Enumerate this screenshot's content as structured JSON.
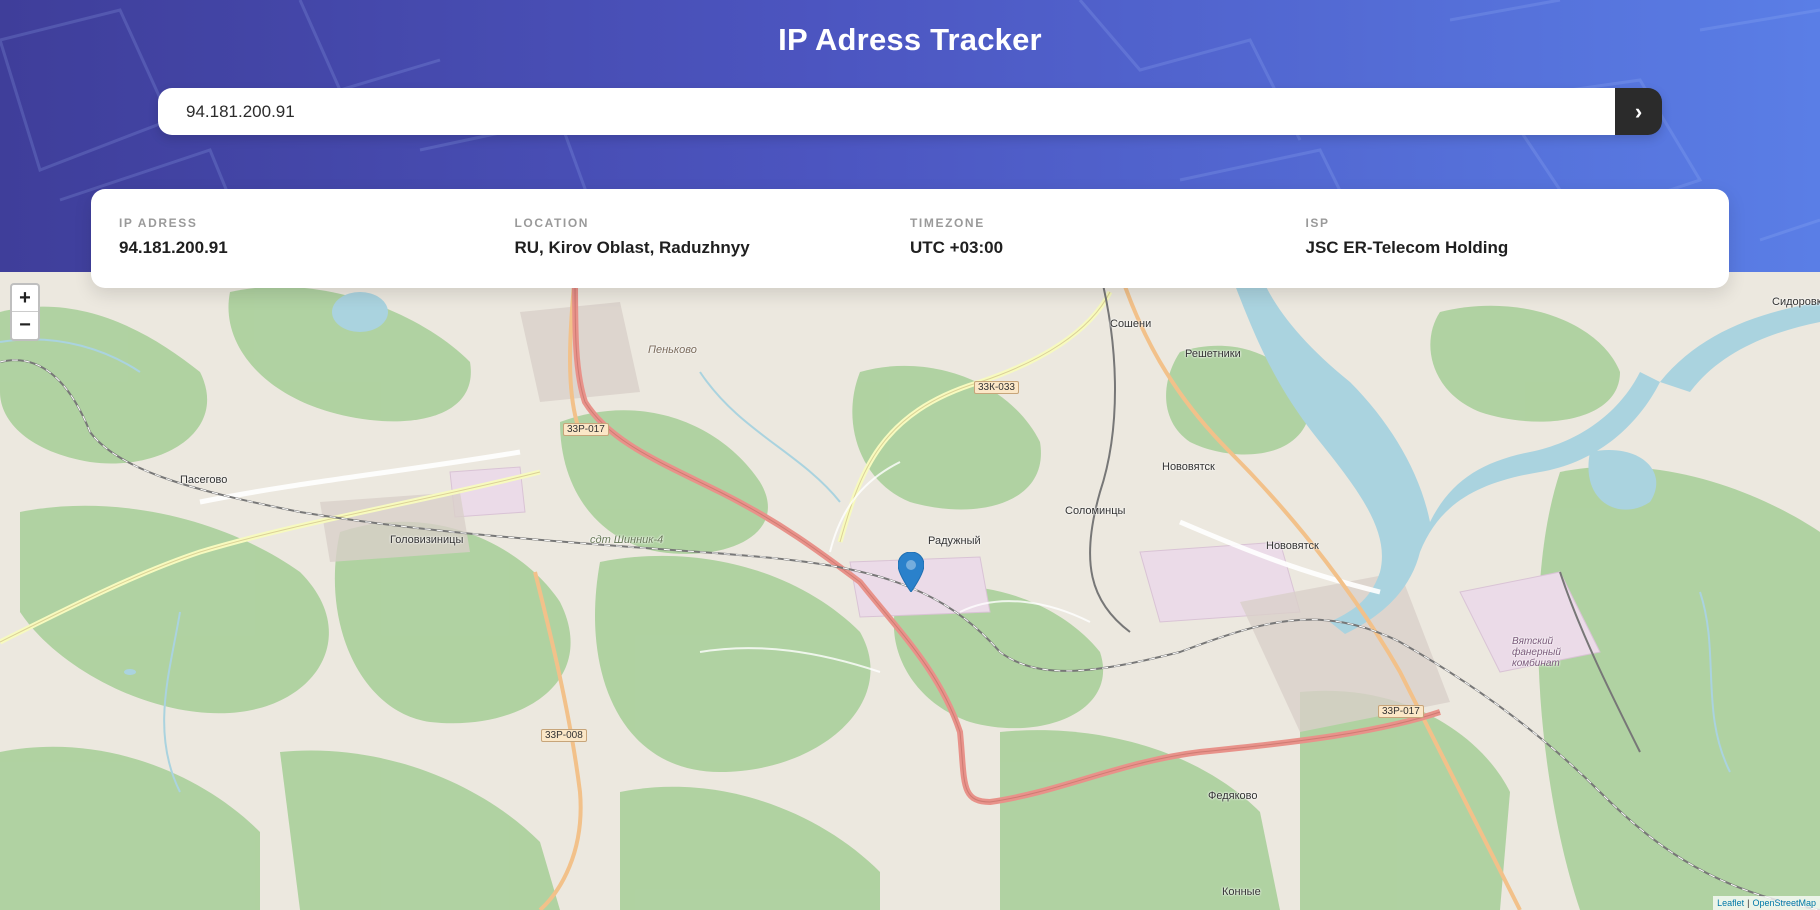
{
  "header": {
    "title": "IP Adress Tracker"
  },
  "search": {
    "value": "94.181.200.91",
    "button_icon": "chevron-right-icon",
    "button_glyph": "›"
  },
  "info": {
    "items": [
      {
        "label": "IP ADRESS",
        "value": "94.181.200.91"
      },
      {
        "label": "LOCATION",
        "value": "RU, Kirov Oblast, Raduzhnyy"
      },
      {
        "label": "TIMEZONE",
        "value": "UTC +03:00"
      },
      {
        "label": "ISP",
        "value": "JSC ER-Telecom Holding"
      }
    ]
  },
  "map": {
    "zoom_in": "+",
    "zoom_out": "−",
    "attribution_leaflet": "Leaflet",
    "attribution_sep": "|",
    "attribution_osm": "OpenStreetMap",
    "marker_icon": "map-pin-icon",
    "places": {
      "sosheni": "Сошени",
      "reshetniki": "Решетники",
      "sidorovka": "Сидоровка",
      "penkovo": "Пеньково",
      "pasegovo": "Пасегово",
      "golovizintsy": "Головизиницы",
      "raduzhny": "Радужный",
      "solomintsy": "Соломинцы",
      "novovyatsk_n": "Нововятск",
      "novovyatsk": "Нововятск",
      "fedyakovo": "Федяково",
      "konnye": "Конные",
      "shinnik": "сдт Шинник-4",
      "kombinat": "Вятский фанерный комбинат"
    },
    "shields": {
      "r1": "33Р-017",
      "r2": "33К-033",
      "r3": "33Р-008",
      "r4": "33Р-017"
    },
    "colors": {
      "land": "#ece8df",
      "forest": "#add19e",
      "water": "#aad3df",
      "primary_road": "#e8928a",
      "secondary_road": "#f7fabf",
      "rail": "#777777",
      "industrial": "#ebdbe8",
      "marker": "#2a81cb"
    }
  }
}
